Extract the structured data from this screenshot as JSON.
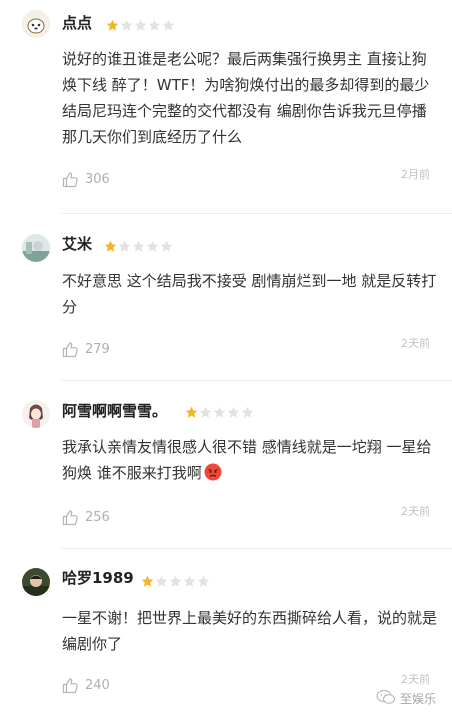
{
  "comments": [
    {
      "username": "点点",
      "rating": 1,
      "rating_max": 5,
      "text": "说好的谁丑谁是老公呢？最后两集强行换男主 直接让狗焕下线 醉了！WTF！为啥狗焕付出的最多却得到的最少 结局尼玛连个完整的交代都没有 编剧你告诉我元旦停播那几天你们到底经历了什么",
      "likes": "306",
      "time": "2月前"
    },
    {
      "username": "艾米",
      "rating": 1,
      "rating_max": 5,
      "text": "不好意思 这个结局我不接受 剧情崩烂到一地 就是反转打分",
      "likes": "279",
      "time": "2天前"
    },
    {
      "username": "阿雪啊啊雪雪。",
      "rating": 1,
      "rating_max": 5,
      "text": "我承认亲情友情很感人很不错 感情线就是一坨翔 一星给狗焕 谁不服来打我啊",
      "emoji": "angry-face-emoji",
      "likes": "256",
      "time": "2天前"
    },
    {
      "username": "哈罗1989",
      "rating": 1,
      "rating_max": 5,
      "text": "一星不谢！把世界上最美好的东西撕碎给人看，说的就是编剧你了",
      "likes": "240",
      "time": "2天前"
    }
  ],
  "colors": {
    "star_filled": "#f5b623",
    "star_empty": "#e2e2e2",
    "meta": "#b0b0b0"
  },
  "watermark": {
    "text": "至娱乐",
    "icon": "wechat-icon"
  }
}
